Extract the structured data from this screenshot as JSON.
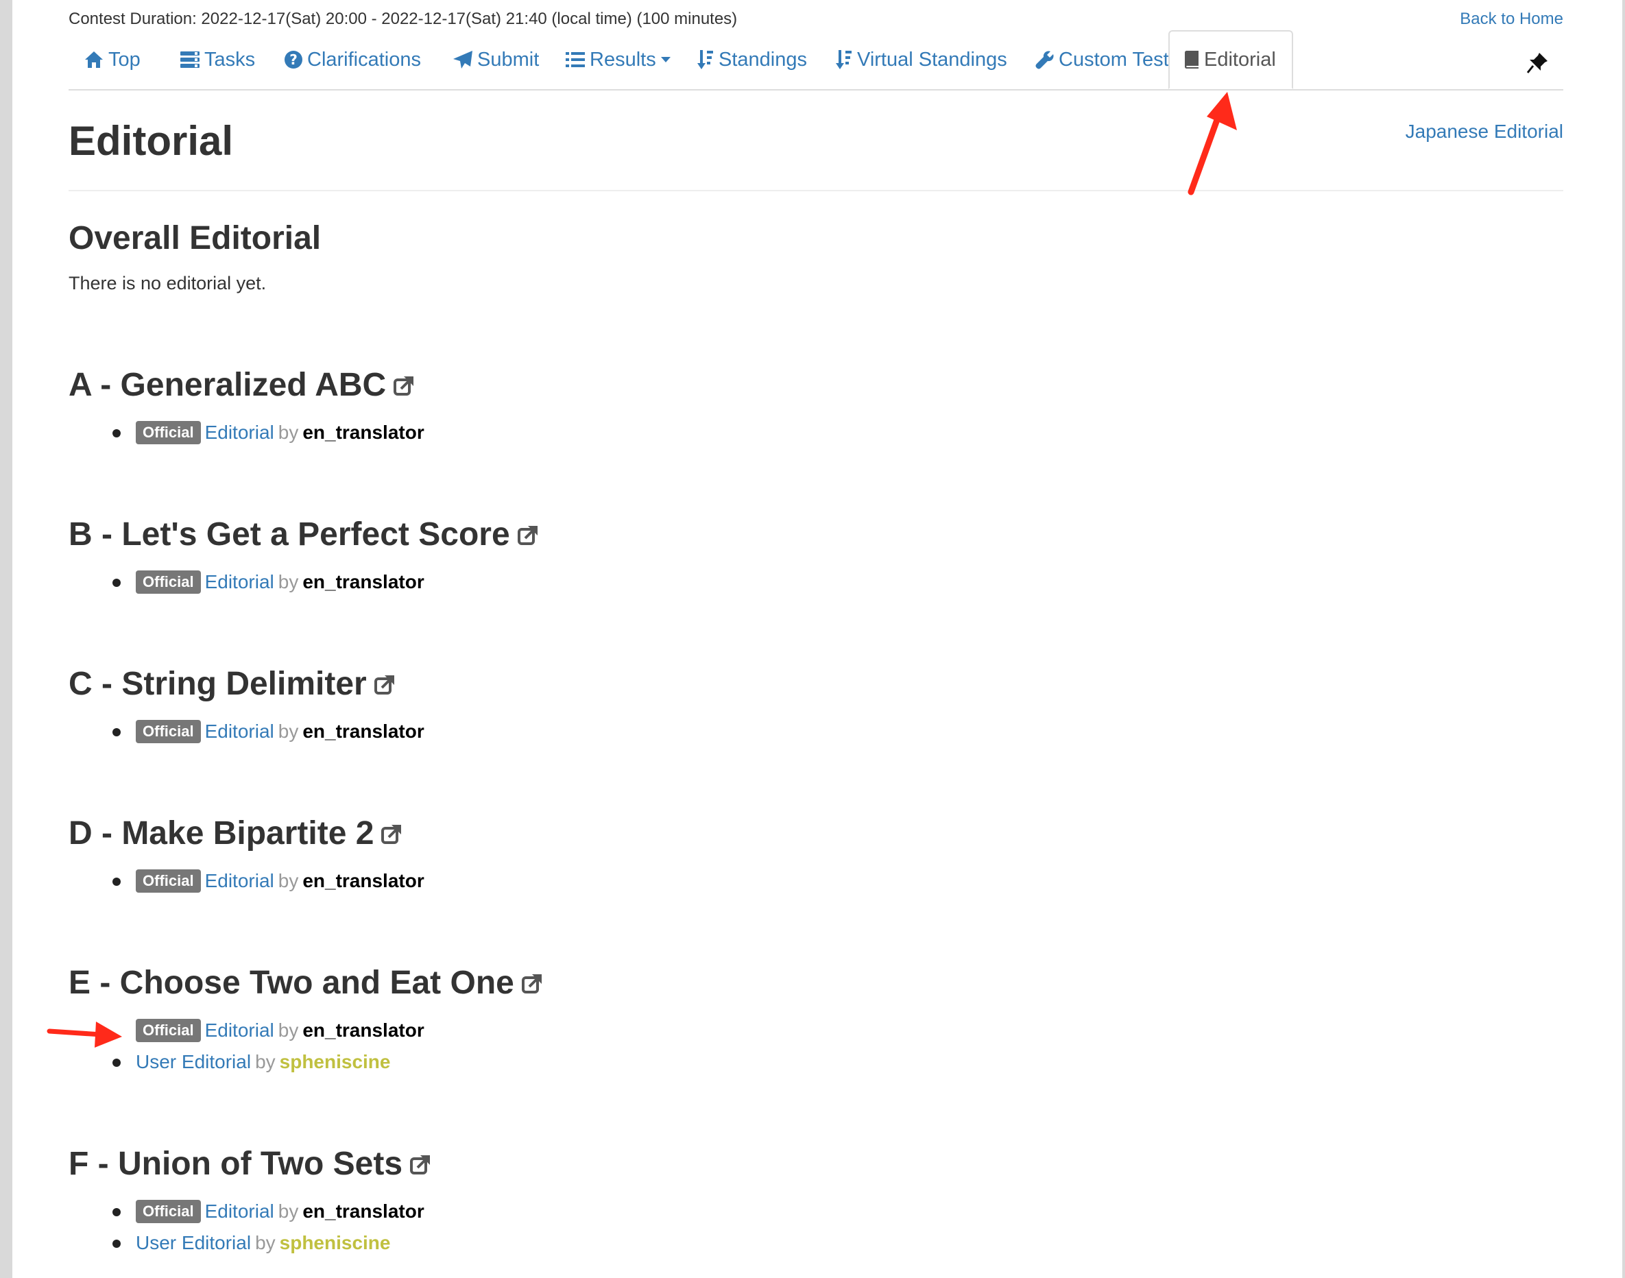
{
  "header": {
    "duration": "Contest Duration: 2022-12-17(Sat) 20:00 - 2022-12-17(Sat) 21:40 (local time) (100 minutes)",
    "back_home": "Back to Home"
  },
  "nav": {
    "items": [
      {
        "label": "Top",
        "icon": "home-icon"
      },
      {
        "label": "Tasks",
        "icon": "tasks-icon"
      },
      {
        "label": "Clarifications",
        "icon": "question-icon"
      },
      {
        "label": "Submit",
        "icon": "send-icon"
      },
      {
        "label": "Results",
        "icon": "list-icon"
      },
      {
        "label": "Standings",
        "icon": "sort-icon"
      },
      {
        "label": "Virtual Standings",
        "icon": "sort-icon"
      },
      {
        "label": "Custom Test",
        "icon": "wrench-icon"
      },
      {
        "label": "Editorial",
        "icon": "book-icon",
        "active": true
      }
    ]
  },
  "main": {
    "title": "Editorial",
    "japanese_link": "Japanese Editorial",
    "overall_heading": "Overall Editorial",
    "overall_text": "There is no editorial yet.",
    "tasks": [
      {
        "title": "A - Generalized ABC",
        "entries": [
          {
            "badge": "Official",
            "link": "Editorial",
            "by": "by",
            "author": "en_translator"
          }
        ]
      },
      {
        "title": "B - Let's Get a Perfect Score",
        "entries": [
          {
            "badge": "Official",
            "link": "Editorial",
            "by": "by",
            "author": "en_translator"
          }
        ]
      },
      {
        "title": "C - String Delimiter",
        "entries": [
          {
            "badge": "Official",
            "link": "Editorial",
            "by": "by",
            "author": "en_translator"
          }
        ]
      },
      {
        "title": "D - Make Bipartite 2",
        "entries": [
          {
            "badge": "Official",
            "link": "Editorial",
            "by": "by",
            "author": "en_translator"
          }
        ]
      },
      {
        "title": "E - Choose Two and Eat One",
        "entries": [
          {
            "badge": "Official",
            "link": "Editorial",
            "by": "by",
            "author": "en_translator"
          },
          {
            "link": "User Editorial",
            "by": "by",
            "author": "spheniscine"
          }
        ]
      },
      {
        "title": "F - Union of Two Sets",
        "entries": [
          {
            "badge": "Official",
            "link": "Editorial",
            "by": "by",
            "author": "en_translator"
          },
          {
            "link": "User Editorial",
            "by": "by",
            "author": "spheniscine"
          }
        ]
      }
    ]
  },
  "colors": {
    "link": "#337ab7",
    "badge": "#777777",
    "user_author": "#c0c040",
    "annotation_arrow": "#ff2a1a"
  }
}
